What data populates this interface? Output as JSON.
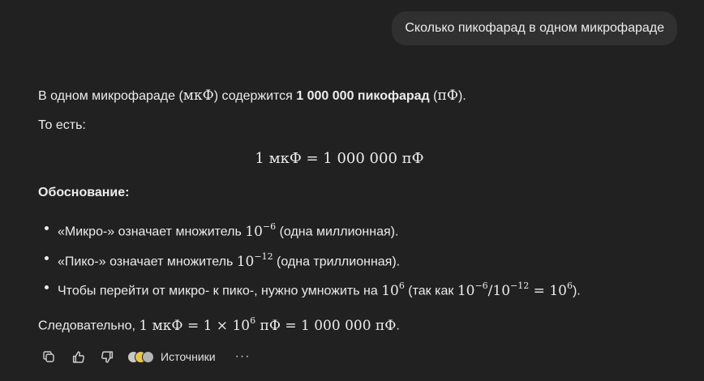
{
  "user_message": "Сколько пикофарад в одном микрофараде",
  "answer": {
    "intro_before": "В одном микрофараде (",
    "intro_unit_mkf": "мкФ",
    "intro_middle": ") содержится ",
    "intro_bold": "1 000 000 пикофарад",
    "intro_open": " (",
    "intro_unit_pf": "пФ",
    "intro_end": ").",
    "that_is": "То есть:",
    "equation": "1 мкФ = 1 000 000 пФ",
    "justification_heading": "Обоснование:",
    "bullets": [
      {
        "text_before": "«Микро-» означает множитель ",
        "math_base": "10",
        "math_exp": "−6",
        "text_after": " (одна миллионная)."
      },
      {
        "text_before": "«Пико-» означает множитель ",
        "math_base": "10",
        "math_exp": "−12",
        "text_after": " (одна триллионная)."
      },
      {
        "text_before": "Чтобы перейти от микро- к пико-, нужно умножить на ",
        "math_base": "10",
        "math_exp": "6",
        "text_middle": " (так как ",
        "math2_a_base": "10",
        "math2_a_exp": "−6",
        "math2_div": "/",
        "math2_b_base": "10",
        "math2_b_exp": "−12",
        "math2_eq": " = ",
        "math2_c_base": "10",
        "math2_c_exp": "6",
        "text_after": ")."
      }
    ],
    "conclusion_prefix": "Следовательно, ",
    "conclusion_math_1": "1 мкФ = 1 × 10",
    "conclusion_exp": "6",
    "conclusion_math_2": " пФ = 1 000 000 пФ",
    "conclusion_end": "."
  },
  "actions": {
    "copy_icon": "copy-icon",
    "like_icon": "thumbs-up-icon",
    "dislike_icon": "thumbs-down-icon",
    "sources_label": "Источники",
    "more_label": "···"
  },
  "colors": {
    "background": "#212121",
    "user_bubble": "#303030",
    "text": "#ececec"
  }
}
